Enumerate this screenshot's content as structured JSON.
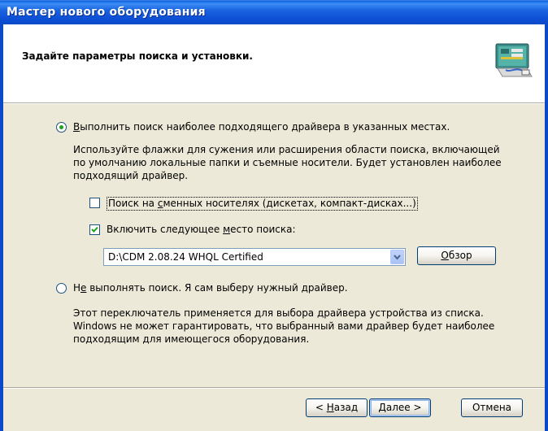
{
  "window": {
    "title": "Мастер нового оборудования"
  },
  "header": {
    "title": "Задайте параметры поиска и установки.",
    "icon": "hardware-wizard-icon"
  },
  "option_search": {
    "label_mnemonic": "В",
    "label_rest": "ыполнить поиск наиболее подходящего драйвера в указанных местах.",
    "selected": true,
    "description_lines": [
      "Используйте флажки для сужения или расширения области поиска, включающей",
      "по умолчанию локальные папки и съемные носители. Будет установлен наиболее",
      "подходящий драйвер."
    ]
  },
  "checkbox_removable": {
    "label_before": "Поиск на ",
    "label_mnemonic": "с",
    "label_after": "менных носителях (дискетах, компакт-дисках...)",
    "checked": false
  },
  "checkbox_location": {
    "label_before": "Включить следующее ",
    "label_mnemonic": "м",
    "label_after": "есто поиска:",
    "checked": true
  },
  "location_combo": {
    "value": "D:\\CDM 2.08.24 WHQL Certified"
  },
  "browse_button": {
    "label_mnemonic": "О",
    "label_rest": "бзор"
  },
  "option_manual": {
    "label_before": "Н",
    "label_mnemonic": "е",
    "label_rest": " выполнять поиск. Я сам выберу нужный драйвер.",
    "selected": false,
    "description_lines": [
      "Этот переключатель применяется для выбора драйвера устройства из списка.",
      "Windows не может гарантировать, что выбранный вами драйвер будет наиболее",
      "подходящим для имеющегося оборудования."
    ]
  },
  "buttons": {
    "back_prefix": "< ",
    "back_mnemonic": "Н",
    "back_rest": "азад",
    "next_mnemonic": "Д",
    "next_rest": "алее >",
    "cancel": "Отмена"
  },
  "colors": {
    "titlebar": "#0A5FE0",
    "dialog_bg": "#ECE9D8",
    "radio_dot": "#21A121",
    "check_mark": "#21A121"
  }
}
